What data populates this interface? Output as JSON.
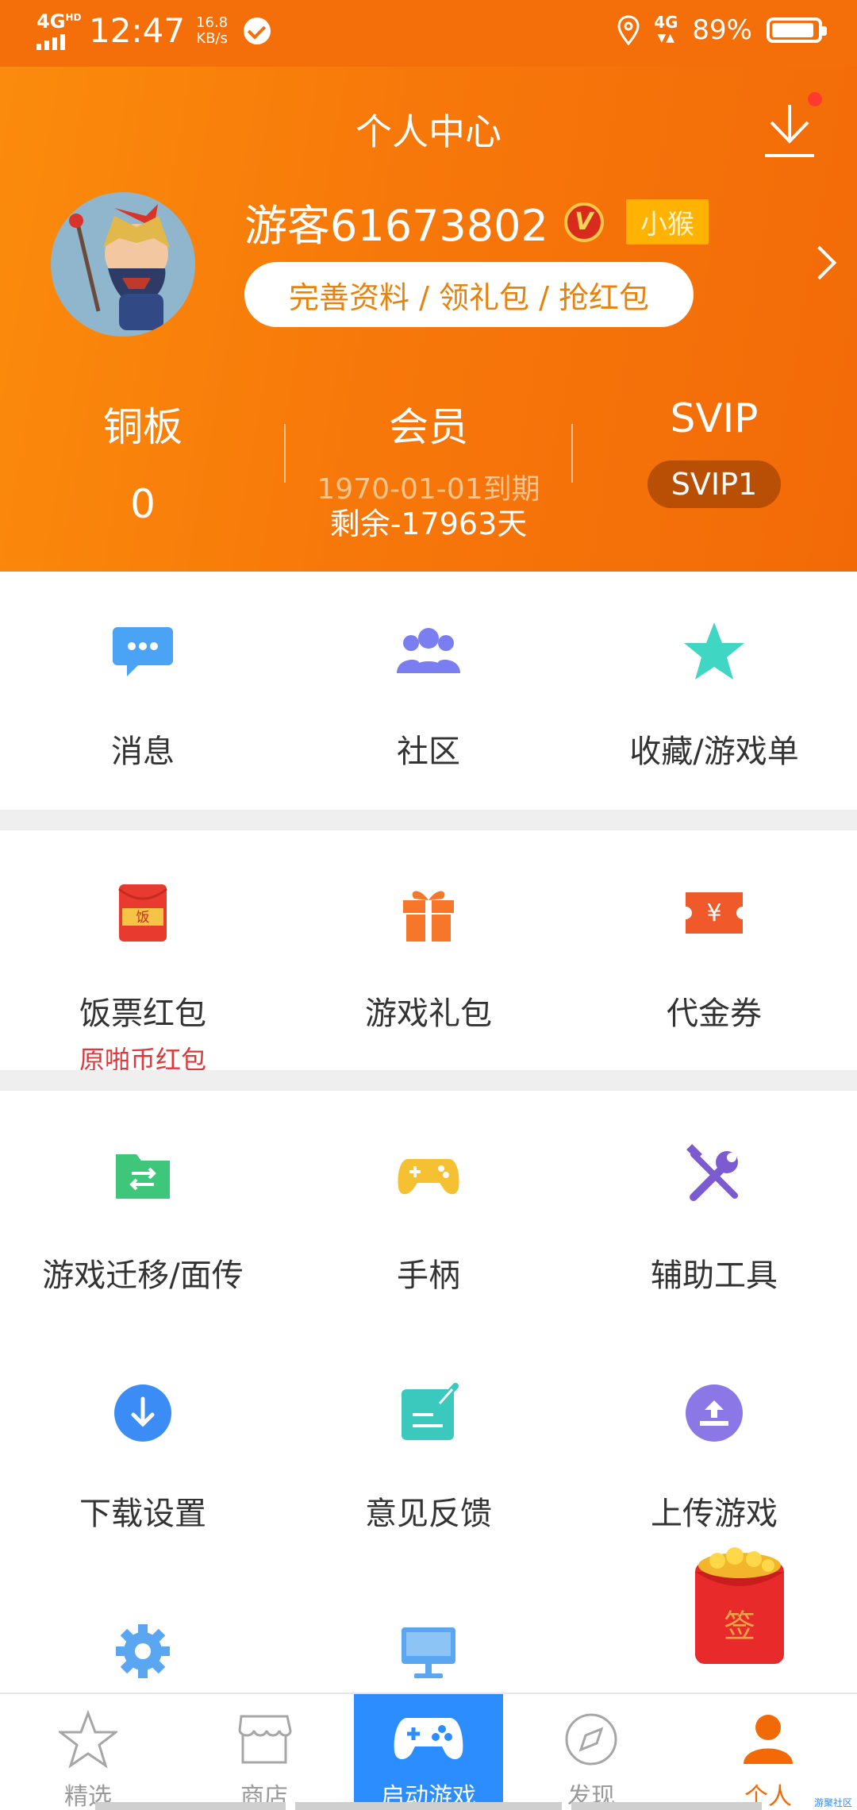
{
  "status_bar": {
    "network": "4G",
    "network_hd": "HD",
    "time": "12:47",
    "speed_value": "16.8",
    "speed_unit": "KB/s",
    "signal_label": "4G",
    "battery": "89%"
  },
  "header": {
    "title": "个人中心",
    "username": "游客61673802",
    "verify_glyph": "V",
    "level_badge": "小猴",
    "profile_pill": "完善资料 / 领礼包 / 抢红包",
    "colors": {
      "gradient_start": "#fb8c0c",
      "gradient_end": "#f26a08",
      "pill_text": "#e8820e"
    }
  },
  "stats": {
    "coins": {
      "label": "铜板",
      "value": "0"
    },
    "member": {
      "label": "会员",
      "expiry": "1970-01-01到期",
      "remaining": "剩余-17963天"
    },
    "svip": {
      "label": "SVIP",
      "level": "SVIP1"
    }
  },
  "grid_section_1": [
    {
      "label": "消息",
      "icon": "message-icon"
    },
    {
      "label": "社区",
      "icon": "community-icon"
    },
    {
      "label": "收藏/游戏单",
      "icon": "star-icon"
    }
  ],
  "grid_section_2": [
    {
      "label": "饭票红包",
      "sub": "原啪币红包",
      "icon": "red-envelope-icon",
      "icon_text": "饭"
    },
    {
      "label": "游戏礼包",
      "icon": "gift-icon"
    },
    {
      "label": "代金券",
      "icon": "coupon-icon",
      "icon_text": "¥"
    }
  ],
  "grid_section_3": [
    {
      "label": "游戏迁移/面传",
      "icon": "folder-transfer-icon"
    },
    {
      "label": "手柄",
      "icon": "gamepad-icon"
    },
    {
      "label": "辅助工具",
      "icon": "tools-icon"
    },
    {
      "label": "下载设置",
      "icon": "download-circle-icon"
    },
    {
      "label": "意见反馈",
      "icon": "feedback-icon"
    },
    {
      "label": "上传游戏",
      "icon": "upload-icon"
    }
  ],
  "partial_row": [
    {
      "icon": "settings-gear-icon"
    },
    {
      "icon": "monitor-icon"
    }
  ],
  "sign_envelope": {
    "text": "签"
  },
  "bottom_nav": [
    {
      "label": "精选",
      "icon": "star-outline-icon"
    },
    {
      "label": "商店",
      "icon": "shop-icon"
    },
    {
      "label": "启动游戏",
      "icon": "gamepad-launch-icon"
    },
    {
      "label": "发现",
      "icon": "compass-icon"
    },
    {
      "label": "个人",
      "icon": "person-icon"
    }
  ],
  "watermark": "游聚社区"
}
